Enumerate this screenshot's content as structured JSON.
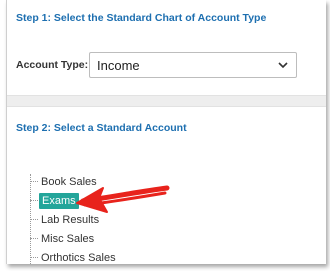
{
  "step1": {
    "title": "Step 1: Select the Standard Chart of Account Type",
    "account_type_label": "Account Type:",
    "account_type_value": "Income"
  },
  "step2": {
    "title": "Step 2: Select a Standard Account",
    "accounts": [
      {
        "label": "Book Sales",
        "selected": false
      },
      {
        "label": "Exams",
        "selected": true
      },
      {
        "label": "Lab Results",
        "selected": false
      },
      {
        "label": "Misc Sales",
        "selected": false
      },
      {
        "label": "Orthotics Sales",
        "selected": false
      }
    ]
  },
  "annotation": {
    "arrow_color": "#e8231c",
    "arrow_target": "Exams"
  },
  "colors": {
    "step_title": "#1d6fb0",
    "selected_item_bg": "#23a59a"
  },
  "icons": {
    "select_chevron": "chevron-down-icon"
  }
}
